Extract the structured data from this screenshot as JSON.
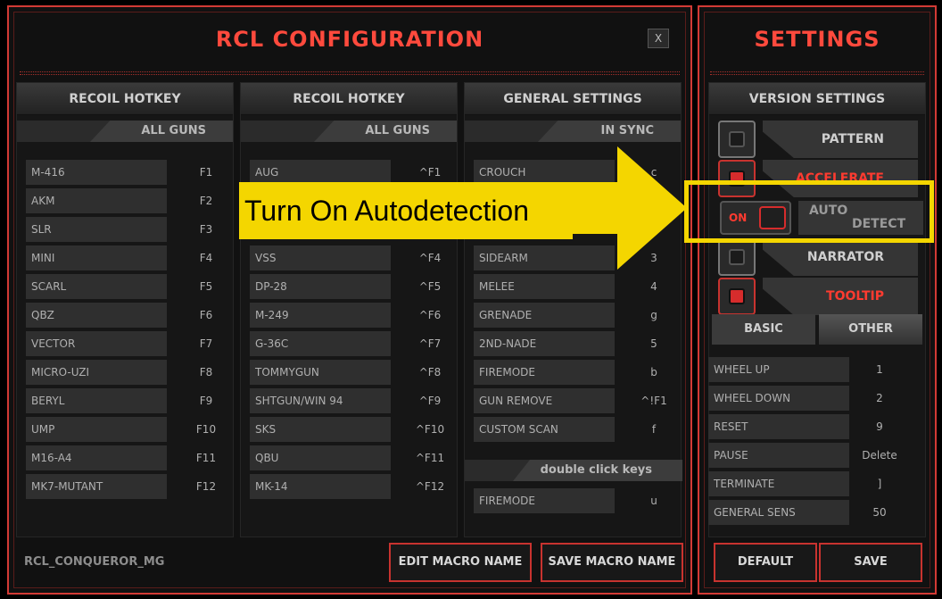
{
  "main": {
    "title": "RCL  CONFIGURATION",
    "close_label": "X",
    "macro_name": "RCL_CONQUEROR_MG",
    "edit_macro_label": "EDIT MACRO NAME",
    "save_macro_label": "SAVE MACRO NAME"
  },
  "panel1": {
    "header": "RECOIL HOTKEY",
    "sub": "ALL GUNS",
    "rows": [
      {
        "label": "M-416",
        "key": "F1"
      },
      {
        "label": "AKM",
        "key": "F2"
      },
      {
        "label": "SLR",
        "key": "F3"
      },
      {
        "label": "MINI",
        "key": "F4"
      },
      {
        "label": "SCARL",
        "key": "F5"
      },
      {
        "label": "QBZ",
        "key": "F6"
      },
      {
        "label": "VECTOR",
        "key": "F7"
      },
      {
        "label": "MICRO-UZI",
        "key": "F8"
      },
      {
        "label": "BERYL",
        "key": "F9"
      },
      {
        "label": "UMP",
        "key": "F10"
      },
      {
        "label": "M16-A4",
        "key": "F11"
      },
      {
        "label": "MK7-MUTANT",
        "key": "F12"
      }
    ]
  },
  "panel2": {
    "header": "RECOIL HOTKEY",
    "sub": "ALL GUNS",
    "rows": [
      {
        "label": "AUG",
        "key": "^F1"
      },
      {
        "label": "VSS",
        "key": "^F4"
      },
      {
        "label": "DP-28",
        "key": "^F5"
      },
      {
        "label": "M-249",
        "key": "^F6"
      },
      {
        "label": "G-36C",
        "key": "^F7"
      },
      {
        "label": "TOMMYGUN",
        "key": "^F8"
      },
      {
        "label": "SHTGUN/WIN 94",
        "key": "^F9"
      },
      {
        "label": "SKS",
        "key": "^F10"
      },
      {
        "label": "QBU",
        "key": "^F11"
      },
      {
        "label": "MK-14",
        "key": "^F12"
      }
    ]
  },
  "panel3": {
    "header": "GENERAL SETTINGS",
    "sub": "IN SYNC",
    "rows": [
      {
        "label": "CROUCH",
        "key": "c"
      },
      {
        "label": "SIDEARM",
        "key": "3"
      },
      {
        "label": "MELEE",
        "key": "4"
      },
      {
        "label": "GRENADE",
        "key": "g"
      },
      {
        "label": "2ND-NADE",
        "key": "5"
      },
      {
        "label": "FIREMODE",
        "key": "b"
      },
      {
        "label": "GUN REMOVE",
        "key": "^!F1"
      },
      {
        "label": "CUSTOM SCAN",
        "key": "f"
      }
    ],
    "double_click_header": "double click keys",
    "double_click_rows": [
      {
        "label": "FIREMODE",
        "key": "u"
      }
    ]
  },
  "settings": {
    "title": "SETTINGS",
    "version_header": "VERSION SETTINGS",
    "toggles": [
      {
        "label": "PATTERN",
        "on": false
      },
      {
        "label": "ACCELERATE",
        "on": true
      },
      {
        "label": "NARRATOR",
        "on": false
      },
      {
        "label": "TOOLTIP",
        "on": true
      }
    ],
    "autodetect": {
      "switch_text": "ON",
      "label_line1": "AUTO",
      "label_line2": "DETECT"
    },
    "tab_basic": "BASIC",
    "tab_other": "OTHER",
    "values": [
      {
        "label": "WHEEL UP",
        "value": "1"
      },
      {
        "label": "WHEEL DOWN",
        "value": "2"
      },
      {
        "label": "RESET",
        "value": "9"
      },
      {
        "label": "PAUSE",
        "value": "Delete"
      },
      {
        "label": "TERMINATE",
        "value": "]"
      },
      {
        "label": "GENERAL SENS",
        "value": "50"
      }
    ],
    "default_label": "DEFAULT",
    "save_label": "SAVE"
  },
  "overlay": {
    "callout_text": "Turn On Autodetection",
    "highlight_color": "#f4d600"
  },
  "colors": {
    "accent": "#d23a35",
    "title": "#ff4a3d"
  }
}
